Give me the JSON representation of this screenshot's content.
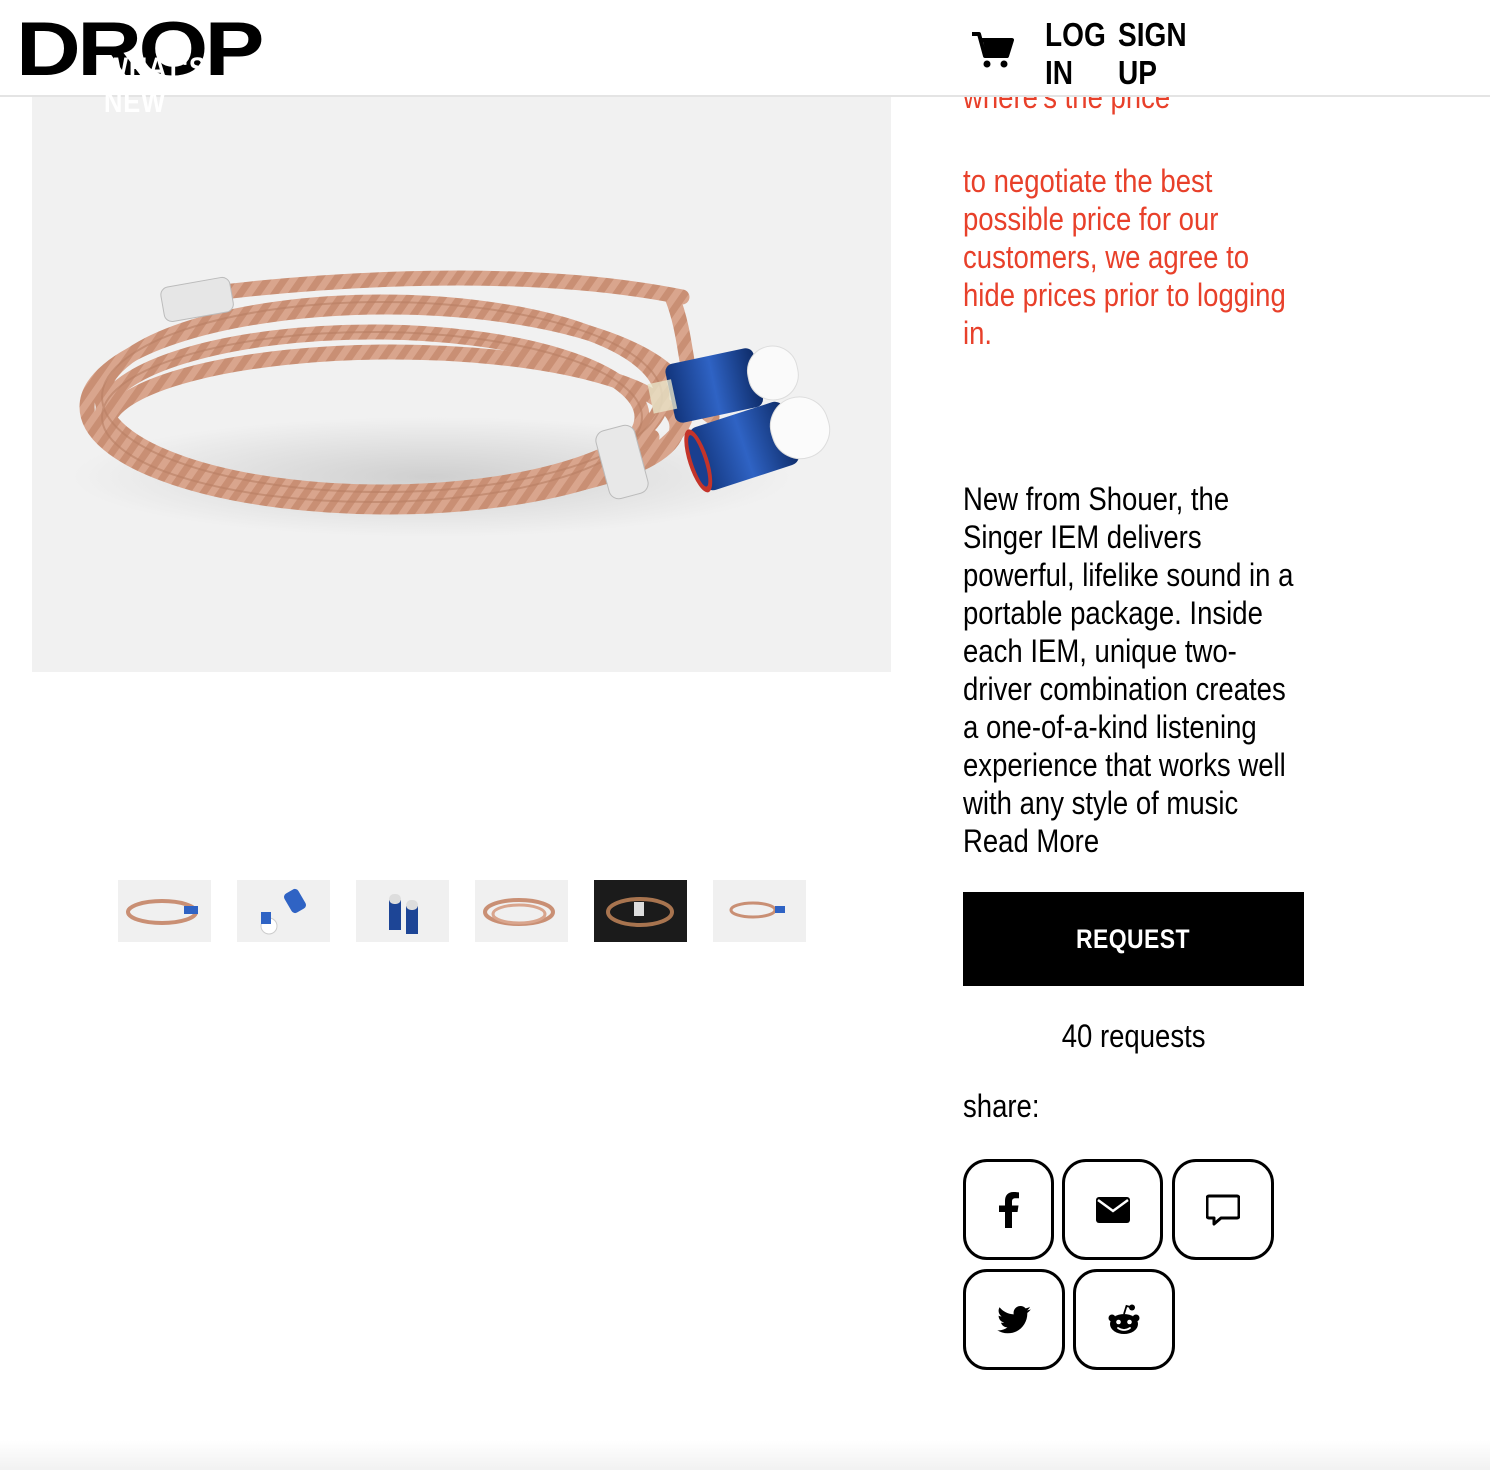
{
  "header": {
    "logo_text": "DROP",
    "nav_overlay": "WHAT'S NEW",
    "login": [
      "LOG",
      "IN"
    ],
    "signup": [
      "SIGN",
      "UP"
    ]
  },
  "product": {
    "price_title": "where's the price",
    "price_message": "to negotiate the best possible price for our customers, we agree to hide prices prior to logging in.",
    "description": "New from Shouer, the Singer IEM delivers powerful, lifelike sound in a portable package. Inside each IEM, unique two-driver combination creates a one-of-a-kind listening experience that works well with any style of music",
    "read_more": "Read More",
    "request_button": "REQUEST",
    "request_count": "40 requests",
    "share_label": "share:"
  },
  "thumbnails": [
    {
      "style": "cable-light"
    },
    {
      "style": "earbuds-white"
    },
    {
      "style": "earbuds-blue"
    },
    {
      "style": "cable-light"
    },
    {
      "style": "dark"
    },
    {
      "style": "cable-light"
    }
  ],
  "colors": {
    "accent_red": "#e8402a",
    "button_black": "#000000",
    "hero_bg": "#f1f1f1"
  },
  "share_icons": [
    "facebook-icon",
    "mail-icon",
    "message-icon",
    "twitter-icon",
    "reddit-icon"
  ]
}
